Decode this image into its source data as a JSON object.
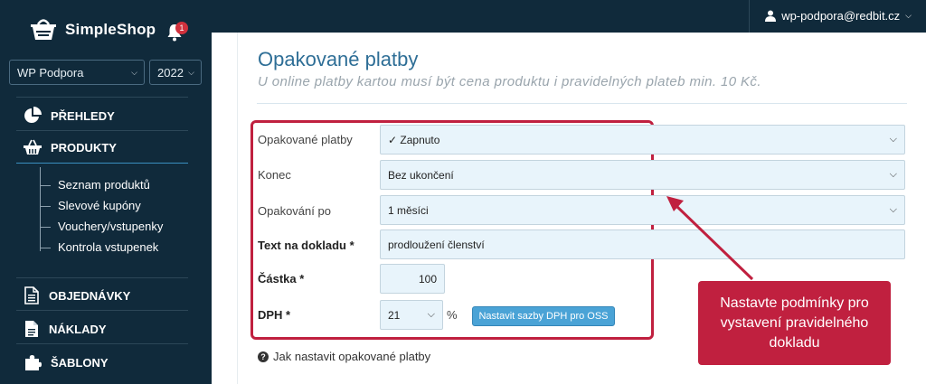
{
  "app": {
    "brand": "SimpleShop",
    "notifications_count": "1",
    "user": "wp-podpora@redbit.cz"
  },
  "sidebar": {
    "workspace": "WP Podpora",
    "year": "2022",
    "items": [
      {
        "label": "PŘEHLEDY",
        "icon": "pie-chart-icon"
      },
      {
        "label": "PRODUKTY",
        "icon": "basket-icon"
      },
      {
        "label": "OBJEDNÁVKY",
        "icon": "document-icon"
      },
      {
        "label": "NÁKLADY",
        "icon": "file-icon"
      },
      {
        "label": "ŠABLONY",
        "icon": "puzzle-icon"
      }
    ],
    "subitems": [
      "Seznam produktů",
      "Slevové kupóny",
      "Vouchery/vstupenky",
      "Kontrola vstupenek"
    ]
  },
  "page": {
    "title": "Opakované platby",
    "subtitle": "U online platby kartou musí být cena produktu i pravidelných plateb min. 10 Kč."
  },
  "form": {
    "recurring_label": "Opakované platby",
    "recurring_value": "✓ Zapnuto",
    "end_label": "Konec",
    "end_value": "Bez ukončení",
    "repeat_label": "Opakování po",
    "repeat_value": "1 měsíci",
    "doc_text_label": "Text na dokladu *",
    "doc_text_value": "prodloužení členství",
    "amount_label": "Částka *",
    "amount_value": "100",
    "vat_label": "DPH *",
    "vat_value": "21",
    "vat_unit": "%",
    "oss_button": "Nastavit sazby DPH pro OSS"
  },
  "help_link": "Jak nastavit opakované platby",
  "callout": {
    "text": "Nastavte podmínky pro vystavení pravidelného dokladu"
  },
  "colors": {
    "sidebar_bg": "#102a3b",
    "accent_red": "#c0203f",
    "title_blue": "#2e6e96",
    "field_bg": "#e8f4fb",
    "button_blue": "#4aa3d6"
  }
}
